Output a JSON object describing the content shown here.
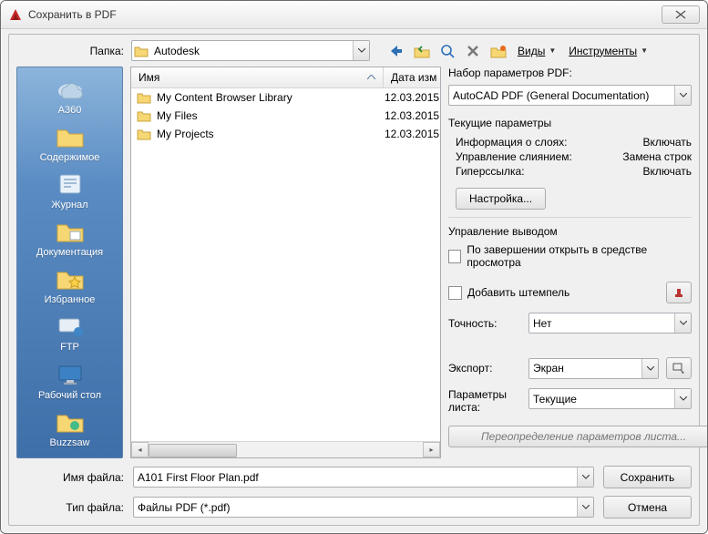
{
  "window": {
    "title": "Сохранить в PDF"
  },
  "toolbar": {
    "folder_label": "Папка:",
    "folder_value": "Autodesk",
    "views_label": "Виды",
    "tools_label": "Инструменты",
    "icons": {
      "back": "back-arrow-icon",
      "up": "up-folder-icon",
      "search": "search-icon",
      "delete": "delete-icon",
      "new": "new-folder-icon"
    }
  },
  "places": [
    {
      "key": "a360",
      "label": "A360"
    },
    {
      "key": "content",
      "label": "Содержимое"
    },
    {
      "key": "journal",
      "label": "Журнал"
    },
    {
      "key": "docs",
      "label": "Документация"
    },
    {
      "key": "fav",
      "label": "Избранное"
    },
    {
      "key": "ftp",
      "label": "FTP"
    },
    {
      "key": "desktop",
      "label": "Рабочий стол"
    },
    {
      "key": "buzzsaw",
      "label": "Buzzsaw"
    }
  ],
  "list": {
    "columns": {
      "name": "Имя",
      "date": "Дата изм"
    },
    "rows": [
      {
        "name": "My Content Browser Library",
        "date": "12.03.2015"
      },
      {
        "name": "My Files",
        "date": "12.03.2015"
      },
      {
        "name": "My Projects",
        "date": "12.03.2015"
      }
    ]
  },
  "right": {
    "preset_label": "Набор параметров PDF:",
    "preset_value": "AutoCAD PDF (General Documentation)",
    "current_label": "Текущие параметры",
    "params": [
      {
        "k": "Информация о слоях:",
        "v": "Включать"
      },
      {
        "k": "Управление слиянием:",
        "v": "Замена строк"
      },
      {
        "k": "Гиперссылка:",
        "v": "Включать"
      }
    ],
    "configure": "Настройка...",
    "output_label": "Управление выводом",
    "open_when_done": "По завершении открыть в средстве просмотра",
    "add_stamp": "Добавить штемпель",
    "precision_label": "Точность:",
    "precision_value": "Нет",
    "export_label": "Экспорт:",
    "export_value": "Экран",
    "sheet_label": "Параметры листа:",
    "sheet_value": "Текущие",
    "sheet_override": "Переопределение параметров листа..."
  },
  "bottom": {
    "filename_label": "Имя файла:",
    "filename_value": "A101 First Floor Plan.pdf",
    "filetype_label": "Тип файла:",
    "filetype_value": "Файлы PDF (*.pdf)",
    "save": "Сохранить",
    "cancel": "Отмена"
  }
}
